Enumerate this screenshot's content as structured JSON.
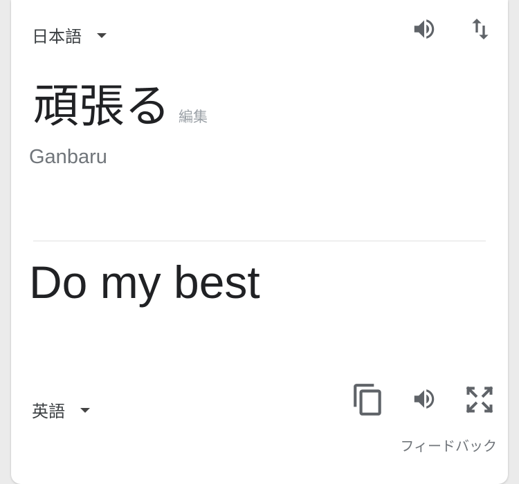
{
  "source": {
    "language": "日本語",
    "text": "頑張る",
    "edit_label": "編集",
    "romanization": "Ganbaru"
  },
  "target": {
    "language": "英語",
    "text": "Do my best"
  },
  "feedback_label": "フィードバック",
  "icons": {
    "source_listen": "speaker-icon",
    "swap": "swap-languages-icon",
    "copy": "copy-icon",
    "target_listen": "speaker-icon",
    "fullscreen": "fullscreen-icon"
  },
  "colors": {
    "icon": "#5f6368",
    "text": "#202124",
    "muted": "#70757a"
  }
}
